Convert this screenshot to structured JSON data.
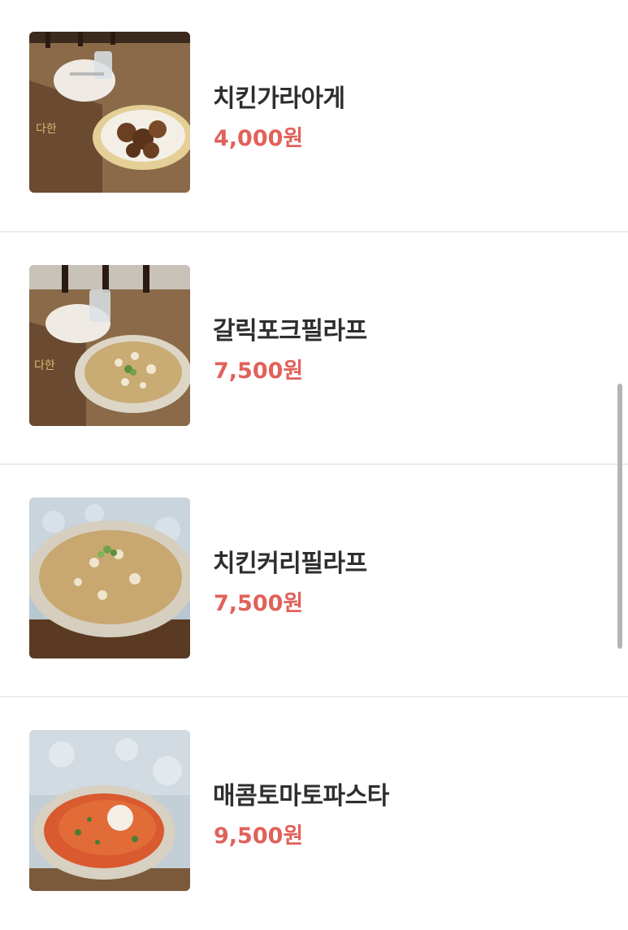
{
  "menu": {
    "items": [
      {
        "name": "치킨가라아게",
        "price": "4,000원",
        "photo": "chicken-karaage-photo"
      },
      {
        "name": "갈릭포크필라프",
        "price": "7,500원",
        "photo": "garlic-pork-pilaf-photo"
      },
      {
        "name": "치킨커리필라프",
        "price": "7,500원",
        "photo": "chicken-curry-pilaf-photo"
      },
      {
        "name": "매콤토마토파스타",
        "price": "9,500원",
        "photo": "spicy-tomato-pasta-photo"
      }
    ]
  },
  "colors": {
    "price": "#e0625a",
    "name": "#2e2e2e",
    "divider": "#ececec",
    "scrollbar": "#b4b4b4"
  }
}
